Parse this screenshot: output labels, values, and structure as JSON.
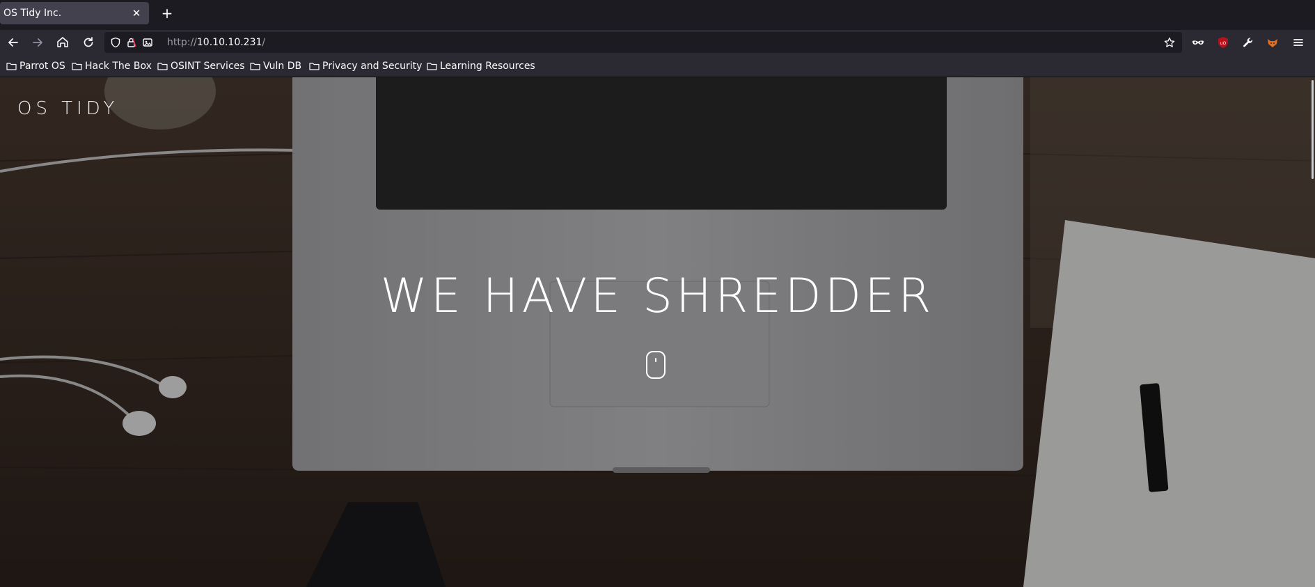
{
  "tab": {
    "title": "OS Tidy Inc.",
    "close": "✕",
    "new_tab": "+"
  },
  "nav": {
    "url_scheme": "http://",
    "url_host": "10.10.10.231",
    "url_path": "/"
  },
  "bookmarks": [
    {
      "label": "Parrot OS"
    },
    {
      "label": "Hack The Box"
    },
    {
      "label": "OSINT Services"
    },
    {
      "label": "Vuln DB"
    },
    {
      "label": "Privacy and Security"
    },
    {
      "label": "Learning Resources"
    }
  ],
  "page": {
    "logo": "OS TIDY",
    "hero_title": "WE HAVE SHREDDER"
  },
  "colors": {
    "browser_bg": "#1c1b22",
    "toolbar": "#2b2a33",
    "tab_active": "#42414d"
  },
  "icons": [
    "back-icon",
    "forward-icon",
    "home-icon",
    "reload-icon",
    "shield-icon",
    "lock-icon",
    "permissions-icon",
    "star-icon",
    "private-mask-icon",
    "ublock-icon",
    "wrench-icon",
    "foxy-icon",
    "hamburger-menu-icon",
    "folder-icon",
    "mouse-scroll-icon"
  ]
}
